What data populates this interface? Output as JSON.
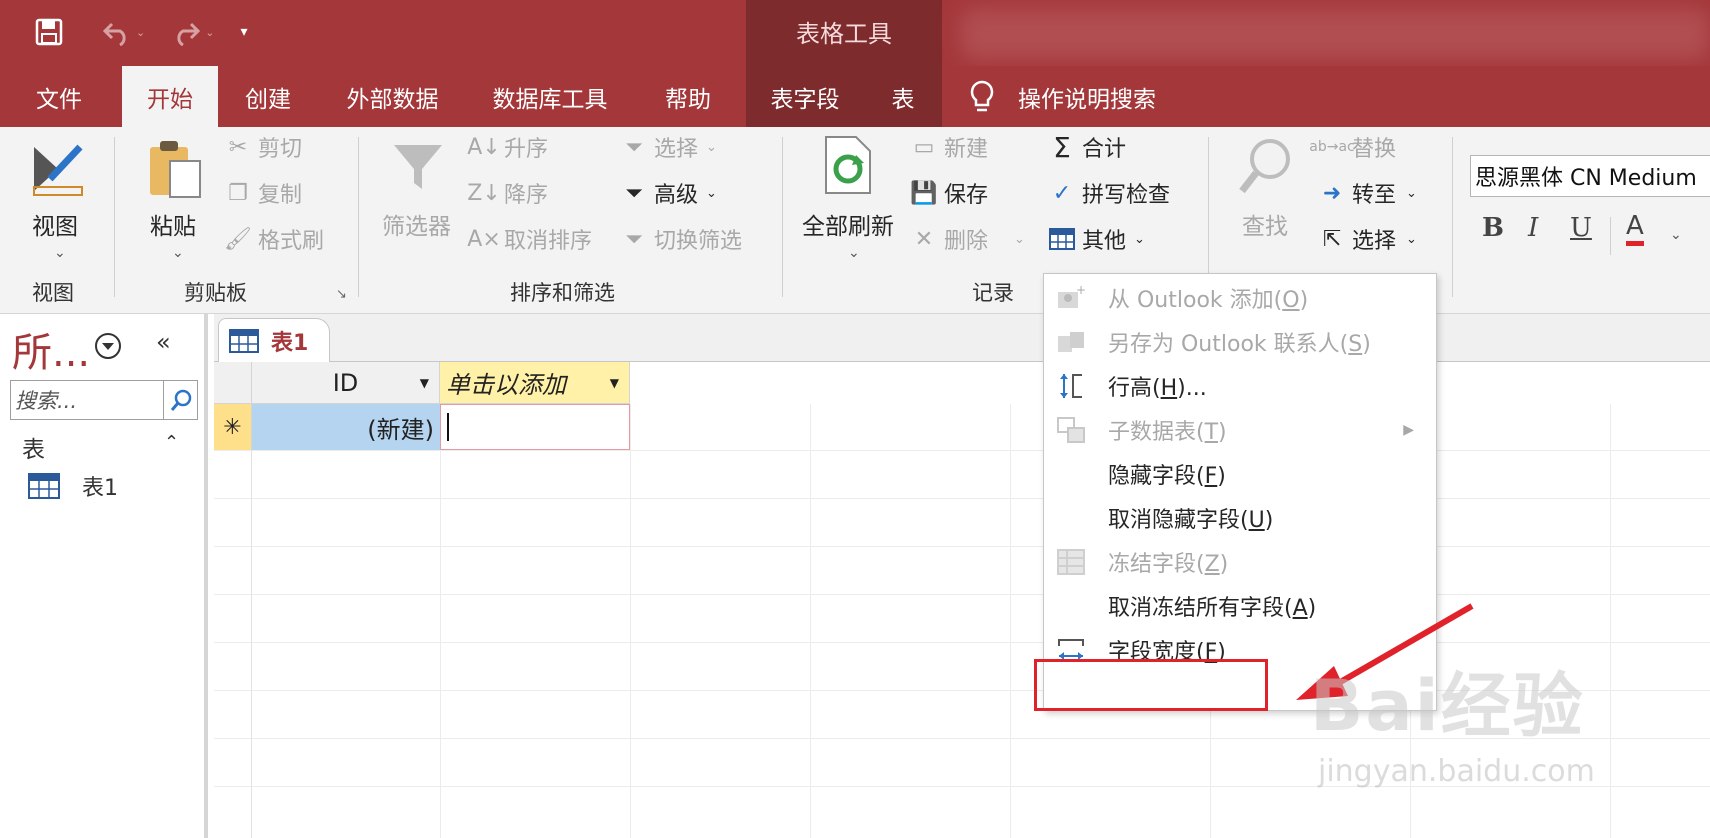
{
  "title_bar": {
    "contextual_tab_group": "表格工具"
  },
  "tabs": [
    {
      "label": "文件"
    },
    {
      "label": "开始",
      "active": true
    },
    {
      "label": "创建"
    },
    {
      "label": "外部数据"
    },
    {
      "label": "数据库工具"
    },
    {
      "label": "帮助"
    },
    {
      "label": "表字段"
    },
    {
      "label": "表"
    }
  ],
  "tell_me": "操作说明搜索",
  "ribbon": {
    "view": {
      "button": "视图",
      "group": "视图"
    },
    "clipboard": {
      "paste": "粘贴",
      "cut": "剪切",
      "copy": "复制",
      "format_painter": "格式刷",
      "group": "剪贴板"
    },
    "sort_filter": {
      "filter": "筛选器",
      "ascending": "升序",
      "descending": "降序",
      "remove_sort": "取消排序",
      "selection": "选择",
      "advanced": "高级",
      "toggle_filter": "切换筛选",
      "group": "排序和筛选"
    },
    "records": {
      "refresh_all": "全部刷新",
      "new": "新建",
      "save": "保存",
      "delete": "删除",
      "totals": "合计",
      "spelling": "拼写检查",
      "more": "其他",
      "group": "记录"
    },
    "find": {
      "find": "查找",
      "replace": "替换",
      "goto": "转至",
      "select": "选择"
    },
    "text_formatting": {
      "font": "思源黑体 CN Medium",
      "bold": "B",
      "italic": "I",
      "underline": "U",
      "font_color": "A"
    }
  },
  "nav_pane": {
    "title": "所...",
    "search_placeholder": "搜索...",
    "section": "表",
    "items": [
      {
        "label": "表1"
      }
    ]
  },
  "document": {
    "tab_label": "表1",
    "columns": [
      {
        "label": "ID"
      },
      {
        "label": "单击以添加"
      }
    ],
    "new_row_value": "(新建)"
  },
  "more_menu": {
    "items": [
      {
        "label": "从 Outlook 添加(",
        "key": "O",
        "suffix": ")",
        "disabled": true,
        "icon": "outlook-add-icon"
      },
      {
        "label": "另存为 Outlook 联系人(",
        "key": "S",
        "suffix": ")",
        "disabled": true,
        "icon": "outlook-contact-icon"
      },
      {
        "label": "行高(",
        "key": "H",
        "suffix": ")...",
        "disabled": false,
        "icon": "row-height-icon"
      },
      {
        "label": "子数据表(",
        "key": "T",
        "suffix": ")",
        "disabled": true,
        "icon": "subdatasheet-icon",
        "submenu": true
      },
      {
        "label": "隐藏字段(",
        "key": "F",
        "suffix": ")",
        "disabled": false
      },
      {
        "label": "取消隐藏字段(",
        "key": "U",
        "suffix": ")",
        "disabled": false
      },
      {
        "label": "冻结字段(",
        "key": "Z",
        "suffix": ")",
        "disabled": true,
        "icon": "freeze-icon"
      },
      {
        "label": "取消冻结所有字段(",
        "key": "A",
        "suffix": ")",
        "disabled": false
      },
      {
        "label": "字段宽度(",
        "key": "F",
        "suffix": ")",
        "disabled": false,
        "icon": "field-width-icon",
        "highlighted": true
      }
    ]
  },
  "watermark": {
    "main": "Bai经验",
    "sub": "jingyan.baidu.com"
  },
  "colors": {
    "accent": "#a4373a",
    "context_tab": "#7e2b2e",
    "highlight_box": "#e0232b"
  }
}
